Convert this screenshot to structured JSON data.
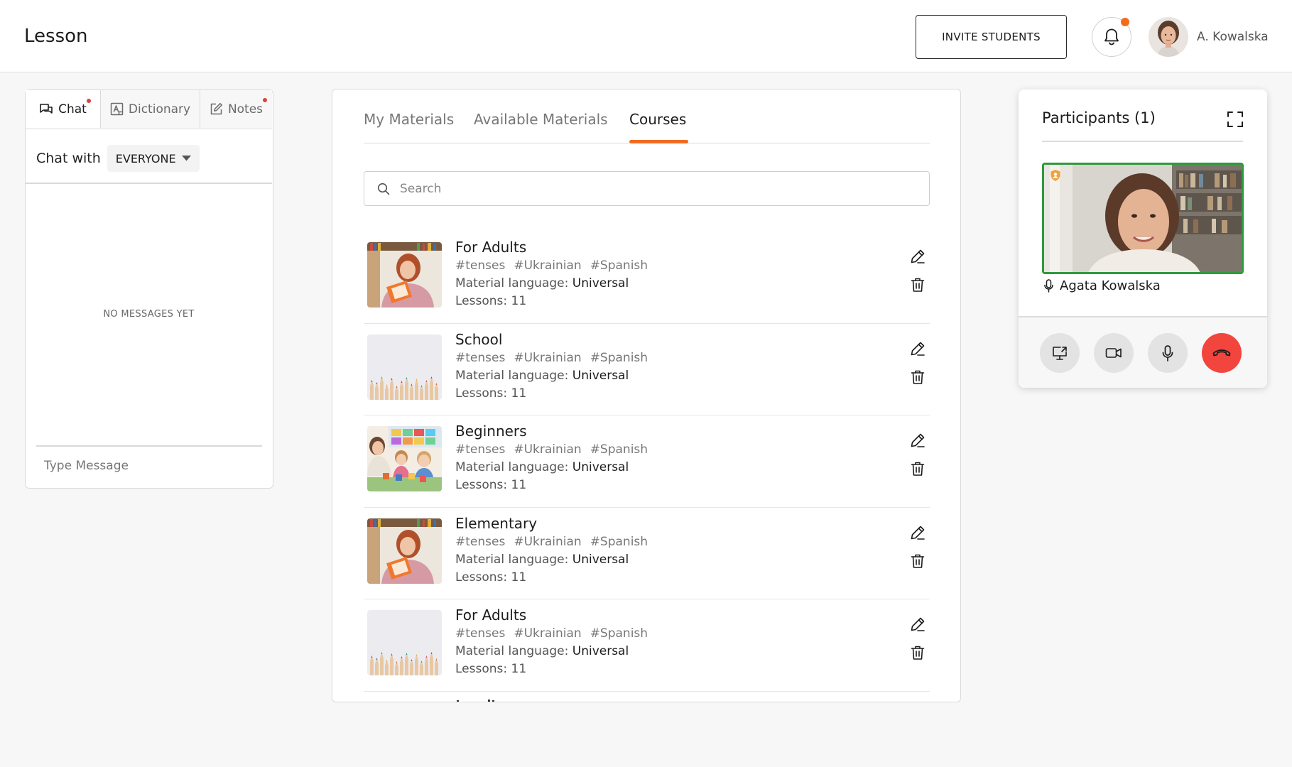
{
  "header": {
    "title": "Lesson",
    "invite_label": "INVITE STUDENTS",
    "user_name": "A. Kowalska"
  },
  "chat": {
    "tabs": [
      {
        "label": "Chat",
        "icon": "chat-icon",
        "active": true,
        "has_dot": true
      },
      {
        "label": "Dictionary",
        "icon": "dictionary-icon",
        "active": false,
        "has_dot": false
      },
      {
        "label": "Notes",
        "icon": "notes-icon",
        "active": false,
        "has_dot": true
      }
    ],
    "chat_with_label": "Chat with",
    "audience": "EVERYONE",
    "empty_text": "NO MESSAGES YET",
    "input_placeholder": "Type Message"
  },
  "materials": {
    "tabs": [
      {
        "label": "My Materials",
        "active": false
      },
      {
        "label": "Available Materials",
        "active": false
      },
      {
        "label": "Courses",
        "active": true
      }
    ],
    "search_placeholder": "Search",
    "lang_label": "Material language:",
    "lessons_label": "Lessons:",
    "courses": [
      {
        "title": "For Adults",
        "tags": [
          "#tenses",
          "#Ukrainian",
          "#Spanish"
        ],
        "language": "Universal",
        "lessons": "11",
        "thumb": "woman-reading"
      },
      {
        "title": "School",
        "tags": [
          "#tenses",
          "#Ukrainian",
          "#Spanish"
        ],
        "language": "Universal",
        "lessons": "11",
        "thumb": "pencils"
      },
      {
        "title": "Beginners",
        "tags": [
          "#tenses",
          "#Ukrainian",
          "#Spanish"
        ],
        "language": "Universal",
        "lessons": "11",
        "thumb": "classroom"
      },
      {
        "title": "Elementary",
        "tags": [
          "#tenses",
          "#Ukrainian",
          "#Spanish"
        ],
        "language": "Universal",
        "lessons": "11",
        "thumb": "woman-reading"
      },
      {
        "title": "For Adults",
        "tags": [
          "#tenses",
          "#Ukrainian",
          "#Spanish"
        ],
        "language": "Universal",
        "lessons": "11",
        "thumb": "pencils"
      }
    ]
  },
  "participants": {
    "title": "Participants (1)",
    "participant_name": "Agata Kowalska",
    "controls": [
      "screen-share-icon",
      "camera-icon",
      "microphone-icon",
      "end-call-icon"
    ]
  },
  "colors": {
    "accent": "#f06b23",
    "notification_dot": "#e0413a",
    "video_border": "#2f9a3e",
    "end_call": "#f2453d"
  }
}
